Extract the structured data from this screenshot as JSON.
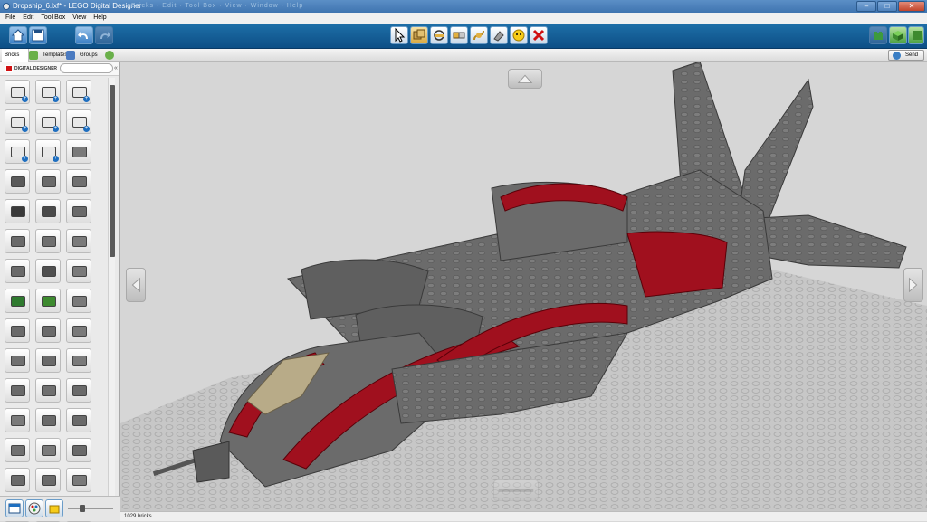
{
  "window": {
    "title": "Dropship_6.lxf* - LEGO Digital Designer",
    "blurred_menu_text": "Bricks · Edit · Tool Box · View · Window · Help",
    "minimize": "–",
    "maximize": "□",
    "close": "✕"
  },
  "menu": {
    "items": [
      "File",
      "Edit",
      "Tool Box",
      "View",
      "Help"
    ]
  },
  "toolbar": {
    "left_buttons": [
      "home-icon",
      "save-icon",
      "undo-icon",
      "redo-icon"
    ],
    "tools": [
      "select-arrow-icon",
      "clone-icon",
      "hinge-icon",
      "hinge-align-icon",
      "flex-icon",
      "paint-icon",
      "hide-icon",
      "delete-icon"
    ],
    "right_buttons": [
      "build-mode-icon",
      "view-mode-icon",
      "building-guide-icon"
    ]
  },
  "tabs": {
    "items": [
      "Bricks",
      "Templates",
      "Groups"
    ],
    "active": "Bricks",
    "send_label": "Send"
  },
  "sidebar": {
    "logo_text": "DIGITAL DESIGNER",
    "search_placeholder": "",
    "collapse_symbol": "«",
    "bricks": [
      {
        "color": "#e8e8e8",
        "plus": true
      },
      {
        "color": "#e8e8e8",
        "plus": true
      },
      {
        "color": "#e8e8e8",
        "plus": true
      },
      {
        "color": "#e8e8e8",
        "plus": true
      },
      {
        "color": "#e8e8e8",
        "plus": true
      },
      {
        "color": "#e8e8e8",
        "plus": true
      },
      {
        "color": "#e8e8e8",
        "plus": true
      },
      {
        "color": "#e8e8e8",
        "plus": true
      },
      {
        "color": "#7a7a7a",
        "plus": false
      },
      {
        "color": "#5a5a5a",
        "plus": false
      },
      {
        "color": "#6a6a6a",
        "plus": false
      },
      {
        "color": "#707070",
        "plus": false
      },
      {
        "color": "#3a3a3a",
        "plus": false
      },
      {
        "color": "#4a4a4a",
        "plus": false
      },
      {
        "color": "#6a6a6a",
        "plus": false
      },
      {
        "color": "#6a6a6a",
        "plus": false
      },
      {
        "color": "#6f6f6f",
        "plus": false
      },
      {
        "color": "#7a7a7a",
        "plus": false
      },
      {
        "color": "#6a6a6a",
        "plus": false
      },
      {
        "color": "#505050",
        "plus": false
      },
      {
        "color": "#7a7a7a",
        "plus": false
      },
      {
        "color": "#2f7a2f",
        "plus": false
      },
      {
        "color": "#3d8a2f",
        "plus": false
      },
      {
        "color": "#7a7a7a",
        "plus": false
      },
      {
        "color": "#6a6a6a",
        "plus": false
      },
      {
        "color": "#6a6a6a",
        "plus": false
      },
      {
        "color": "#7a7a7a",
        "plus": false
      },
      {
        "color": "#707070",
        "plus": false
      },
      {
        "color": "#6a6a6a",
        "plus": false
      },
      {
        "color": "#7a7a7a",
        "plus": false
      },
      {
        "color": "#6a6a6a",
        "plus": false
      },
      {
        "color": "#707070",
        "plus": false
      },
      {
        "color": "#6a6a6a",
        "plus": false
      },
      {
        "color": "#7a7a7a",
        "plus": false
      },
      {
        "color": "#6a6a6a",
        "plus": false
      },
      {
        "color": "#6a6a6a",
        "plus": false
      },
      {
        "color": "#707070",
        "plus": false
      },
      {
        "color": "#7a7a7a",
        "plus": false
      },
      {
        "color": "#6a6a6a",
        "plus": false
      },
      {
        "color": "#6a6a6a",
        "plus": false
      },
      {
        "color": "#6a6a6a",
        "plus": false
      },
      {
        "color": "#7a7a7a",
        "plus": false
      },
      {
        "color": "#6a6a6a",
        "plus": false
      },
      {
        "color": "#6a6a6a",
        "plus": false
      },
      {
        "color": "#6a6a6a",
        "plus": false
      }
    ],
    "zoom_level": 0.3
  },
  "viewport": {
    "colors": {
      "hull": "#6b6b6b",
      "hull_dark": "#4a4a4a",
      "accent": "#a0101e",
      "canopy": "#b8ab88",
      "baseplate": "#c6c6c6"
    }
  },
  "status": {
    "brick_count": "1029 bricks"
  }
}
